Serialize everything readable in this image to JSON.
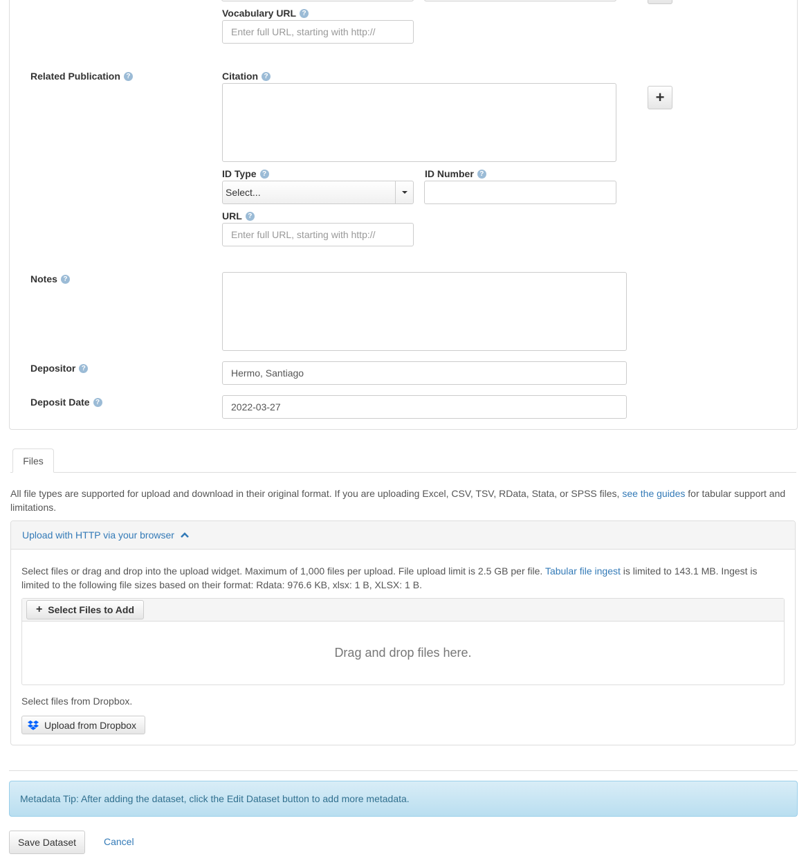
{
  "vocab": {
    "url_label": "Vocabulary URL",
    "url_placeholder": "Enter full URL, starting with http://"
  },
  "related_publication": {
    "label": "Related Publication",
    "citation_label": "Citation",
    "id_type_label": "ID Type",
    "id_type_value": "Select...",
    "id_number_label": "ID Number",
    "url_label": "URL",
    "url_placeholder": "Enter full URL, starting with http://",
    "add_button": "+"
  },
  "notes": {
    "label": "Notes"
  },
  "depositor": {
    "label": "Depositor",
    "value": "Hermo, Santiago"
  },
  "deposit_date": {
    "label": "Deposit Date",
    "value": "2022-03-27"
  },
  "help_glyph": "?",
  "files": {
    "tab_label": "Files",
    "intro_text_1": "All file types are supported for upload and download in their original format. If you are uploading Excel, CSV, TSV, RData, Stata, or SPSS files,",
    "intro_link": "see the guides",
    "intro_text_2": "for tabular support and",
    "intro_text_3": "limitations.",
    "upload_panel_title": "Upload with HTTP via your browser",
    "upload_desc_1": "Select files or drag and drop into the upload widget. Maximum of 1,000 files per upload. File upload limit is 2.5 GB per file.",
    "upload_desc_link": "Tabular file ingest",
    "upload_desc_2": "is limited to 143.1 MB. Ingest is",
    "upload_desc_3": "limited to the following file sizes based on their format: Rdata: 976.6 KB, xlsx: 1 B, XLSX: 1 B.",
    "select_files_button": "Select Files to Add",
    "drop_text": "Drag and drop files here.",
    "dropbox_text": "Select files from Dropbox.",
    "dropbox_button": "Upload from Dropbox"
  },
  "tip": {
    "text": "Metadata Tip: After adding the dataset, click the Edit Dataset button to add more metadata."
  },
  "actions": {
    "save": "Save Dataset",
    "cancel": "Cancel"
  }
}
